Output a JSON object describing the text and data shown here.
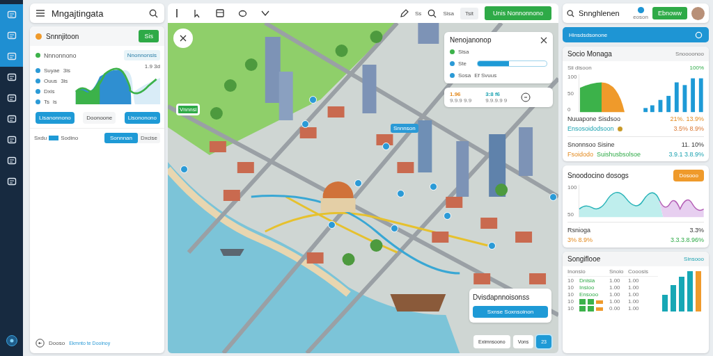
{
  "sidebar": {
    "items": [
      {
        "selected": true
      },
      {
        "selected": true
      },
      {
        "selected": true
      },
      {
        "selected": false
      },
      {
        "selected": false
      },
      {
        "selected": false
      },
      {
        "selected": false
      },
      {
        "selected": false
      },
      {
        "selected": false
      }
    ]
  },
  "app_header": {
    "title": "Mngajtingata"
  },
  "left_card": {
    "title": "Snnnjitoon",
    "action": "Sis",
    "legend": "Nnnonnono",
    "chip": "Nnonnonsis",
    "reading": "1.9 3d",
    "rows": [
      {
        "label": "Suyae",
        "value": "3is"
      },
      {
        "label": "Ouus",
        "value": "3is"
      },
      {
        "label": "Dxis",
        "value": ""
      },
      {
        "label": "Ts",
        "value": "is"
      }
    ],
    "buttons": [
      {
        "label": "Lisanonnono",
        "kind": "primary"
      },
      {
        "label": "Doonoone",
        "kind": "plain"
      },
      {
        "label": "Lisononono",
        "kind": "primary"
      }
    ],
    "filter": {
      "label": "Sxdu",
      "swatch_label": "Sodino"
    },
    "tabs": [
      {
        "label": "Sonnnan",
        "selected": true
      },
      {
        "label": "Dxcise",
        "selected": false
      }
    ]
  },
  "left_footer": {
    "text": "Dooso",
    "link": "Ekmnto te Dooinoy"
  },
  "toolbar": {
    "search_hint": "Ss",
    "label": "Sisa",
    "chip": "Tsit",
    "button": "Unis Nonnonnono"
  },
  "map": {
    "marker_label": "Vnnnsi",
    "place_label": "Snnnson"
  },
  "map_panel": {
    "title": "Nenojanonop",
    "rows": [
      {
        "label": "Sisa",
        "kind": "status"
      },
      {
        "label": "Ste",
        "kind": "progress",
        "level": 0.45
      },
      {
        "label": "Sosa",
        "kind": "text",
        "value": "Ef Svuus"
      }
    ]
  },
  "map_stats": [
    {
      "value": "1.96",
      "caption": "9.9.9 9.9"
    },
    {
      "value": "3:8 f6",
      "caption": "9.9.9.9 9"
    }
  ],
  "map_bottom_panel": {
    "title": "Dvisdapnnoisonss",
    "button": "Sxnse  Soxnsoinon"
  },
  "map_buttons": [
    {
      "label": "Eximnsoono",
      "selected": false
    },
    {
      "label": "Vons",
      "selected": false
    },
    {
      "label": "23",
      "selected": true
    }
  ],
  "right_header": {
    "search": "Snnghlenen",
    "icon_caption": "eoson",
    "button": "Ebnoww"
  },
  "banner": {
    "title": "Hinsdsdsonone"
  },
  "stats_card": {
    "title": "Socio Monaga",
    "subtitle": "Snoooonoo",
    "chart_title": "Sii disoon",
    "chart_value": "100%",
    "y_labels": [
      "100",
      "50",
      "0"
    ],
    "metrics": [
      {
        "label": "Nuuapone Sisdsoo",
        "value": "21%. 13.9%"
      },
      {
        "label": "Ensosoidodsoon",
        "value": "3.5% 8.9%"
      }
    ],
    "summary": {
      "label": "Snonnsoo Sisine",
      "value": "11. 10%",
      "tags": [
        "Fsoidodo",
        "Suishusbsolsoe"
      ],
      "total": "3.9.1 3.8.9%"
    }
  },
  "trend_card": {
    "title": "Snoodocino dosogs",
    "button": "Dosooo",
    "y_labels": [
      "100",
      "50"
    ],
    "label": "Rsnioga",
    "value": "3.3%",
    "left_value": "3% 8.9%",
    "right_value": "3.3.3.8.96%"
  },
  "table_card": {
    "title": "Songiflooe",
    "chip": "Sinsooo",
    "columns": [
      "Inonsio",
      "Snoio",
      "Cooosis"
    ],
    "rows": [
      {
        "cells": [
          "10",
          "Dnisia",
          "1.00",
          "1.00"
        ]
      },
      {
        "cells": [
          "10",
          "Insioo",
          "1.00",
          "1.00"
        ]
      },
      {
        "cells": [
          "10",
          "Ensooo",
          "1.00",
          "1.00"
        ]
      },
      {
        "cells": [
          "10",
          "1.00",
          "1.00"
        ],
        "kind": "bars"
      },
      {
        "cells": [
          "10",
          "0.00",
          "1.00"
        ],
        "kind": "bars"
      }
    ]
  }
}
